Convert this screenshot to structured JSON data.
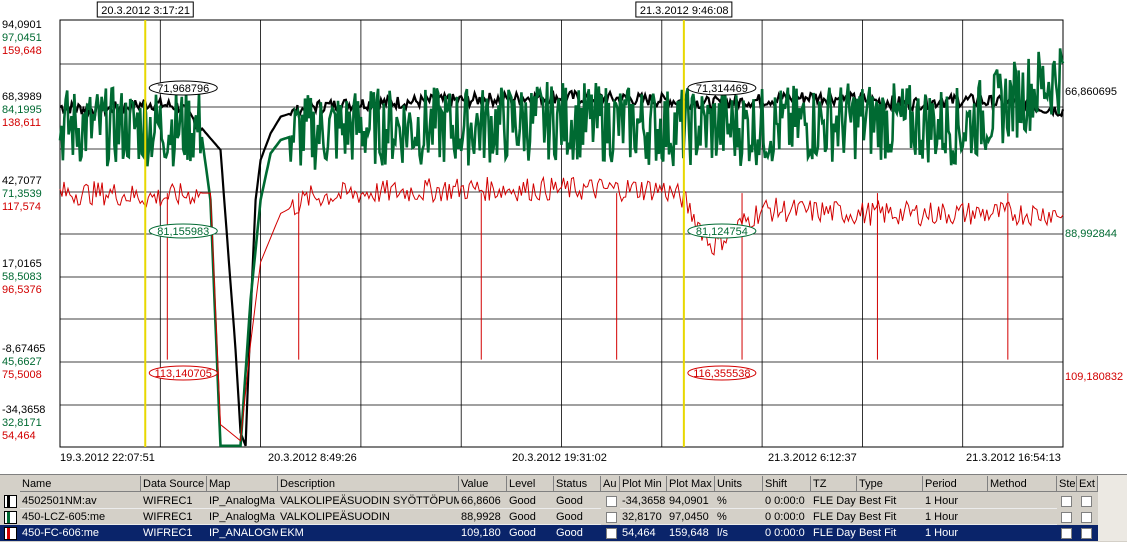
{
  "cursors": [
    {
      "label": "20.3.2012  3:17:21",
      "t": 0.085,
      "readouts": [
        {
          "text": "71,968796",
          "series": 0
        },
        {
          "text": "81,155983",
          "series": 1
        },
        {
          "text": "113,140705",
          "series": 2
        }
      ]
    },
    {
      "label": "21.3.2012  9:46:08",
      "t": 0.622,
      "readouts": [
        {
          "text": "71,314469",
          "series": 0
        },
        {
          "text": "81,124754",
          "series": 1
        },
        {
          "text": "116,355538",
          "series": 2
        }
      ]
    }
  ],
  "chart_data": {
    "type": "line",
    "x_labels": [
      "19.3.2012  22:07:51",
      "20.3.2012  8:49:26",
      "20.3.2012  19:31:02",
      "21.3.2012  6:12:37",
      "21.3.2012  16:54:13"
    ],
    "y_scales": [
      {
        "series": "4502501NM:av",
        "color": "#000000",
        "min": -34.3658,
        "max": 94.0901,
        "ticks": [
          "94,0901",
          "68,3989",
          "42,7077",
          "17,0165",
          "-8,67465",
          "-34,3658"
        ]
      },
      {
        "series": "450-LCZ-605:me",
        "color": "#006a32",
        "min": 32.8171,
        "max": 97.0451,
        "ticks": [
          "97,0451",
          "84,1995",
          "71,3539",
          "58,5083",
          "45,6627",
          "32,8171"
        ]
      },
      {
        "series": "450-FC-606:me",
        "color": "#d20000",
        "min": 54.464,
        "max": 159.648,
        "ticks": [
          "159,648",
          "138,611",
          "117,574",
          "96,5376",
          "75,5008",
          "54,464"
        ]
      }
    ],
    "series": [
      {
        "name": "4502501NM:av",
        "color": "#000000",
        "current_value": "66,860695",
        "x": [
          0,
          0.04,
          0.09,
          0.12,
          0.14,
          0.16,
          0.175,
          0.18,
          0.185,
          0.19,
          0.195,
          0.2,
          0.21,
          0.22,
          0.25,
          0.3,
          0.4,
          0.5,
          0.6,
          0.65,
          0.7,
          0.75,
          0.8,
          0.85,
          0.9,
          0.95,
          1.0
        ],
        "y": [
          68,
          67,
          69,
          68,
          62,
          55,
          -5,
          -30,
          -34,
          5,
          40,
          52,
          60,
          65,
          68,
          69,
          70,
          71,
          70,
          69,
          70,
          71,
          70,
          69,
          70,
          69,
          66.86
        ]
      },
      {
        "name": "450-LCZ-605:me",
        "color": "#006a32",
        "current_value": "88,992844",
        "x": [
          0,
          0.05,
          0.1,
          0.14,
          0.15,
          0.16,
          0.18,
          0.19,
          0.2,
          0.21,
          0.22,
          0.24,
          0.3,
          0.4,
          0.5,
          0.6,
          0.7,
          0.8,
          0.9,
          1.0
        ],
        "y": [
          81,
          81,
          81,
          81,
          70,
          33,
          33,
          55,
          70,
          77,
          79,
          80,
          81,
          81,
          82,
          81,
          81,
          82,
          81,
          88.99
        ]
      },
      {
        "name": "450-FC-606:me",
        "color": "#d20000",
        "current_value": "109,180832",
        "x": [
          0,
          0.05,
          0.085,
          0.1,
          0.14,
          0.15,
          0.16,
          0.18,
          0.19,
          0.2,
          0.22,
          0.25,
          0.3,
          0.4,
          0.5,
          0.6,
          0.62,
          0.65,
          0.7,
          0.8,
          0.9,
          1.0
        ],
        "y": [
          117,
          117,
          116,
          116,
          117,
          117,
          60,
          56,
          80,
          100,
          112,
          116,
          117,
          118,
          118,
          118,
          116,
          104,
          113,
          112,
          112,
          112
        ]
      }
    ]
  },
  "table": {
    "headers": [
      "Name",
      "Data Source",
      "Map",
      "Description",
      "Value",
      "Level",
      "Status",
      "Au",
      "Plot Min",
      "Plot Max",
      "Units",
      "Shift",
      "TZ",
      "Type",
      "Period",
      "Method",
      "Ste",
      "Ext"
    ],
    "rows": [
      {
        "swatch": "#000000",
        "name": "4502501NM:av",
        "source": "WIFREC1",
        "map": "IP_AnalogMa",
        "desc": "VALKOLIPEÄSUODIN SYÖTTÖPUM",
        "value": "66,8606",
        "level": "Good",
        "status": "Good",
        "min": "-34,3658",
        "max": "94,0901",
        "units": "%",
        "shift": "0  0:00:0",
        "tz": "FLE Day",
        "type": "Best Fit",
        "period": "1 Hour",
        "method": "",
        "selected": false
      },
      {
        "swatch": "#006a32",
        "name": "450-LCZ-605:me",
        "source": "WIFREC1",
        "map": "IP_AnalogMa",
        "desc": "VALKOLIPEÄSUODIN",
        "value": "88,9928",
        "level": "Good",
        "status": "Good",
        "min": "32,8170",
        "max": "97,0450",
        "units": "%",
        "shift": "0  0:00:0",
        "tz": "FLE Day",
        "type": "Best Fit",
        "period": "1 Hour",
        "method": "",
        "selected": false
      },
      {
        "swatch": "#d20000",
        "name": "450-FC-606:me",
        "source": "WIFREC1",
        "map": "IP_ANALOGM",
        "desc": "EKM",
        "value": "109,180",
        "level": "Good",
        "status": "Good",
        "min": "54,464",
        "max": "159,648",
        "units": "l/s",
        "shift": "0  0:00:0",
        "tz": "FLE Day",
        "type": "Best Fit",
        "period": "1 Hour",
        "method": "",
        "selected": true
      }
    ]
  }
}
